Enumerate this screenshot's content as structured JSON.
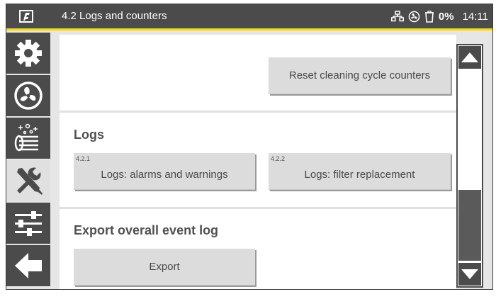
{
  "header": {
    "title": "4.2 Logs and counters",
    "logo_icon": "brand-logo",
    "status": {
      "network_icon": "network-icon",
      "fan_icon": "fan-status-icon",
      "bin_icon": "dust-bin-icon",
      "fill_level": "0%",
      "time": "14:11"
    }
  },
  "sidebar": {
    "items": [
      {
        "name": "settings",
        "icon": "gear-icon"
      },
      {
        "name": "fan",
        "icon": "fan-icon"
      },
      {
        "name": "cleaning",
        "icon": "filter-cleaning-icon"
      },
      {
        "name": "service",
        "icon": "tools-icon",
        "active": true
      },
      {
        "name": "adjustments",
        "icon": "sliders-icon"
      },
      {
        "name": "back",
        "icon": "back-arrow-icon"
      }
    ]
  },
  "main": {
    "reset_button": "Reset cleaning cycle counters",
    "logs": {
      "title": "Logs",
      "buttons": [
        {
          "number": "4.2.1",
          "label": "Logs: alarms and warnings"
        },
        {
          "number": "4.2.2",
          "label": "Logs: filter replacement"
        }
      ]
    },
    "export": {
      "title": "Export overall event log",
      "button": "Export"
    }
  },
  "scrollbar": {
    "up_icon": "triangle-up-icon",
    "down_icon": "triangle-down-icon",
    "position": 1.0
  },
  "colors": {
    "header_bg": "#4b4b4b",
    "accent": "#f1d21c",
    "button_bg": "#dcdcdc",
    "panel_bg": "#ffffff"
  }
}
